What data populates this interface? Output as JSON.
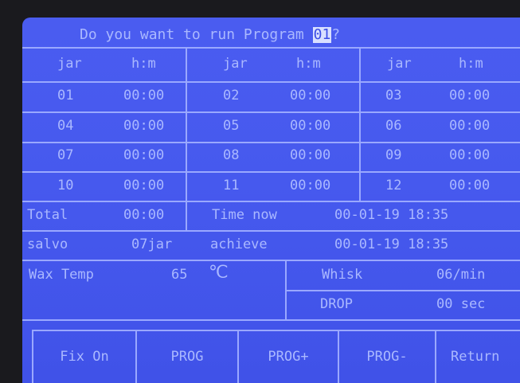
{
  "header": {
    "prompt_prefix": "Do you want to run Program ",
    "program_number": "01",
    "prompt_suffix": "?"
  },
  "table": {
    "columns": [
      "jar",
      "h:m",
      "jar",
      "h:m",
      "jar",
      "h:m"
    ],
    "rows": [
      [
        "01",
        "00:00",
        "02",
        "00:00",
        "03",
        "00:00"
      ],
      [
        "04",
        "00:00",
        "05",
        "00:00",
        "06",
        "00:00"
      ],
      [
        "07",
        "00:00",
        "08",
        "00:00",
        "09",
        "00:00"
      ],
      [
        "10",
        "00:00",
        "11",
        "00:00",
        "12",
        "00:00"
      ]
    ]
  },
  "summary": {
    "total_label": "Total",
    "total_value": "00:00",
    "time_now_label": "Time now",
    "time_now_value": "00-01-19 18:35",
    "salvo_label": "salvo",
    "salvo_value": "07jar",
    "achieve_label": "achieve",
    "achieve_value": "00-01-19 18:35"
  },
  "settings": {
    "wax_temp_label": "Wax Temp",
    "wax_temp_value": "65",
    "wax_temp_unit": "℃",
    "whisk_label": "Whisk",
    "whisk_value": "06/min",
    "drop_label": "DROP",
    "drop_value": "00 sec"
  },
  "buttons": [
    "Fix On",
    "PROG",
    "PROG+",
    "PROG-",
    "Return"
  ],
  "colors": {
    "screen_bg": "#4659ee",
    "grid_line": "#9aa8ff",
    "text": "#aab8ff",
    "highlight": "#d9e0ff"
  }
}
